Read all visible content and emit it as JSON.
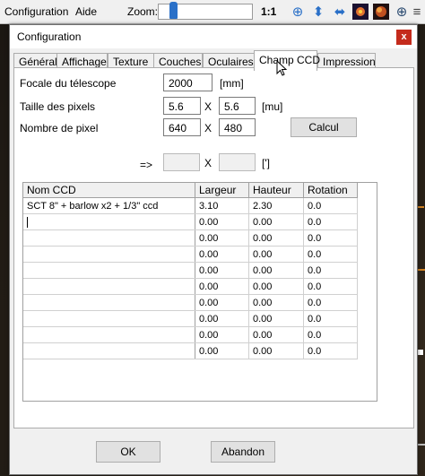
{
  "app": {
    "menu": [
      "Configuration",
      "Aide"
    ],
    "zoom_label": "Zoom:",
    "zoom_ratio": "1:1",
    "zoom_level": 0.13,
    "toolbar_icons": [
      "globe-grid-icon",
      "four-way-arrows-icon",
      "horizontal-arrows-icon",
      "galaxy-image-icon",
      "nebula-image-icon",
      "globe-icon",
      "equatorial-grid-icon"
    ]
  },
  "dialog": {
    "title": "Configuration",
    "close_label": "x",
    "tabs": [
      "Général",
      "Affichage",
      "Texture",
      "Couches",
      "Oculaires",
      "Champ CCD",
      "Impression"
    ],
    "active_tab": "Champ CCD",
    "form": {
      "focal_label": "Focale du télescope",
      "focal_value": "2000",
      "focal_unit": "[mm]",
      "pixel_size_label": "Taille des pixels",
      "pixel_size_x": "5.6",
      "pixel_size_y": "5.6",
      "pixel_size_unit": "[mu]",
      "pixel_count_label": "Nombre de pixel",
      "pixel_count_x": "640",
      "pixel_count_y": "480",
      "x_sep": "X",
      "calc_button": "Calcul",
      "result_arrow": "=>",
      "result_x": "",
      "result_y": "",
      "result_unit": "[']"
    },
    "grid": {
      "columns": [
        "Nom CCD",
        "Largeur",
        "Hauteur",
        "Rotation"
      ],
      "rows": [
        [
          "SCT 8\" + barlow x2 + 1/3\" ccd",
          "3.10",
          "2.30",
          "0.0"
        ],
        [
          "",
          "0.00",
          "0.00",
          "0.0"
        ],
        [
          "",
          "0.00",
          "0.00",
          "0.0"
        ],
        [
          "",
          "0.00",
          "0.00",
          "0.0"
        ],
        [
          "",
          "0.00",
          "0.00",
          "0.0"
        ],
        [
          "",
          "0.00",
          "0.00",
          "0.0"
        ],
        [
          "",
          "0.00",
          "0.00",
          "0.0"
        ],
        [
          "",
          "0.00",
          "0.00",
          "0.0"
        ],
        [
          "",
          "0.00",
          "0.00",
          "0.0"
        ],
        [
          "",
          "0.00",
          "0.00",
          "0.0"
        ]
      ]
    },
    "ok_button": "OK",
    "cancel_button": "Abandon"
  },
  "colors": {
    "accent": "#2a70c8",
    "close": "#c42b1c"
  }
}
